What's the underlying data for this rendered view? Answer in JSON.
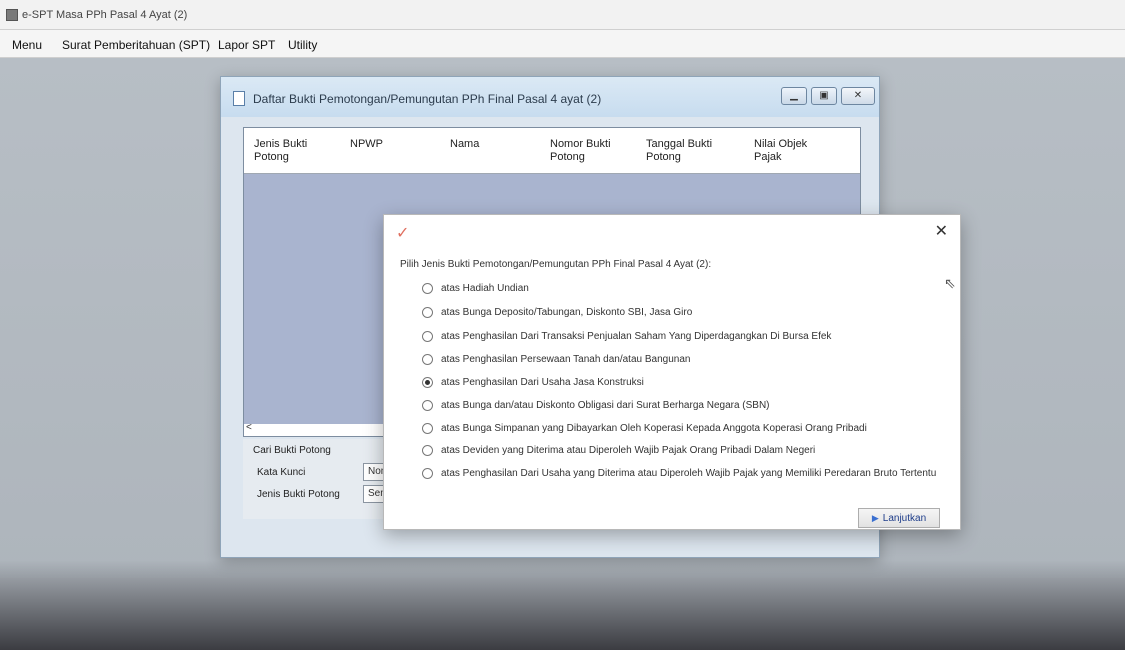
{
  "app": {
    "title": "e-SPT Masa PPh Pasal 4 Ayat (2)"
  },
  "menu": [
    "Menu",
    "Surat Pemberitahuan (SPT)",
    "Lapor SPT",
    "Utility"
  ],
  "back_window": {
    "title": "Daftar Bukti Pemotongan/Pemungutan PPh Final Pasal 4 ayat (2)",
    "columns": [
      {
        "line1": "Jenis Bukti",
        "line2": "Potong"
      },
      {
        "line1": "NPWP",
        "line2": ""
      },
      {
        "line1": "Nama",
        "line2": ""
      },
      {
        "line1": "Nomor Bukti",
        "line2": "Potong"
      },
      {
        "line1": "Tanggal Bukti",
        "line2": "Potong"
      },
      {
        "line1": "Nilai Objek",
        "line2": "Pajak"
      }
    ],
    "scroll_left_glyph": "<",
    "search": {
      "group_label": "Cari Bukti Potong",
      "keyword_label": "Kata Kunci",
      "keyword_value": "Nomor",
      "type_label": "Jenis Bukti Potong",
      "type_value": "Semua"
    }
  },
  "dialog": {
    "check_glyph": "✓",
    "close_glyph": "✕",
    "prompt": "Pilih Jenis Bukti Pemotongan/Pemungutan PPh Final Pasal 4 Ayat (2):",
    "options": [
      {
        "label": "atas Hadiah Undian",
        "selected": false
      },
      {
        "label": "atas Bunga Deposito/Tabungan, Diskonto SBI, Jasa Giro",
        "selected": false
      },
      {
        "label": "atas Penghasilan Dari Transaksi Penjualan Saham Yang Diperdagangkan Di Bursa Efek",
        "selected": false
      },
      {
        "label": "atas Penghasilan Persewaan Tanah dan/atau Bangunan",
        "selected": false
      },
      {
        "label": "atas Penghasilan Dari Usaha Jasa Konstruksi",
        "selected": true
      },
      {
        "label": "atas Bunga dan/atau Diskonto Obligasi dari Surat Berharga Negara (SBN)",
        "selected": false
      },
      {
        "label": "atas Bunga Simpanan yang Dibayarkan Oleh Koperasi Kepada Anggota Koperasi Orang Pribadi",
        "selected": false
      },
      {
        "label": "atas Deviden yang Diterima atau Diperoleh Wajib Pajak Orang Pribadi Dalam Negeri",
        "selected": false
      },
      {
        "label": "atas Penghasilan Dari Usaha yang Diterima atau Diperoleh Wajib Pajak yang Memiliki Peredaran Bruto Tertentu",
        "selected": false
      }
    ],
    "next_button": "Lanjutkan",
    "next_arrow_glyph": "▶"
  },
  "colors": {
    "grid_body": "#a9b4cf",
    "link_blue": "#1e3d8a"
  }
}
